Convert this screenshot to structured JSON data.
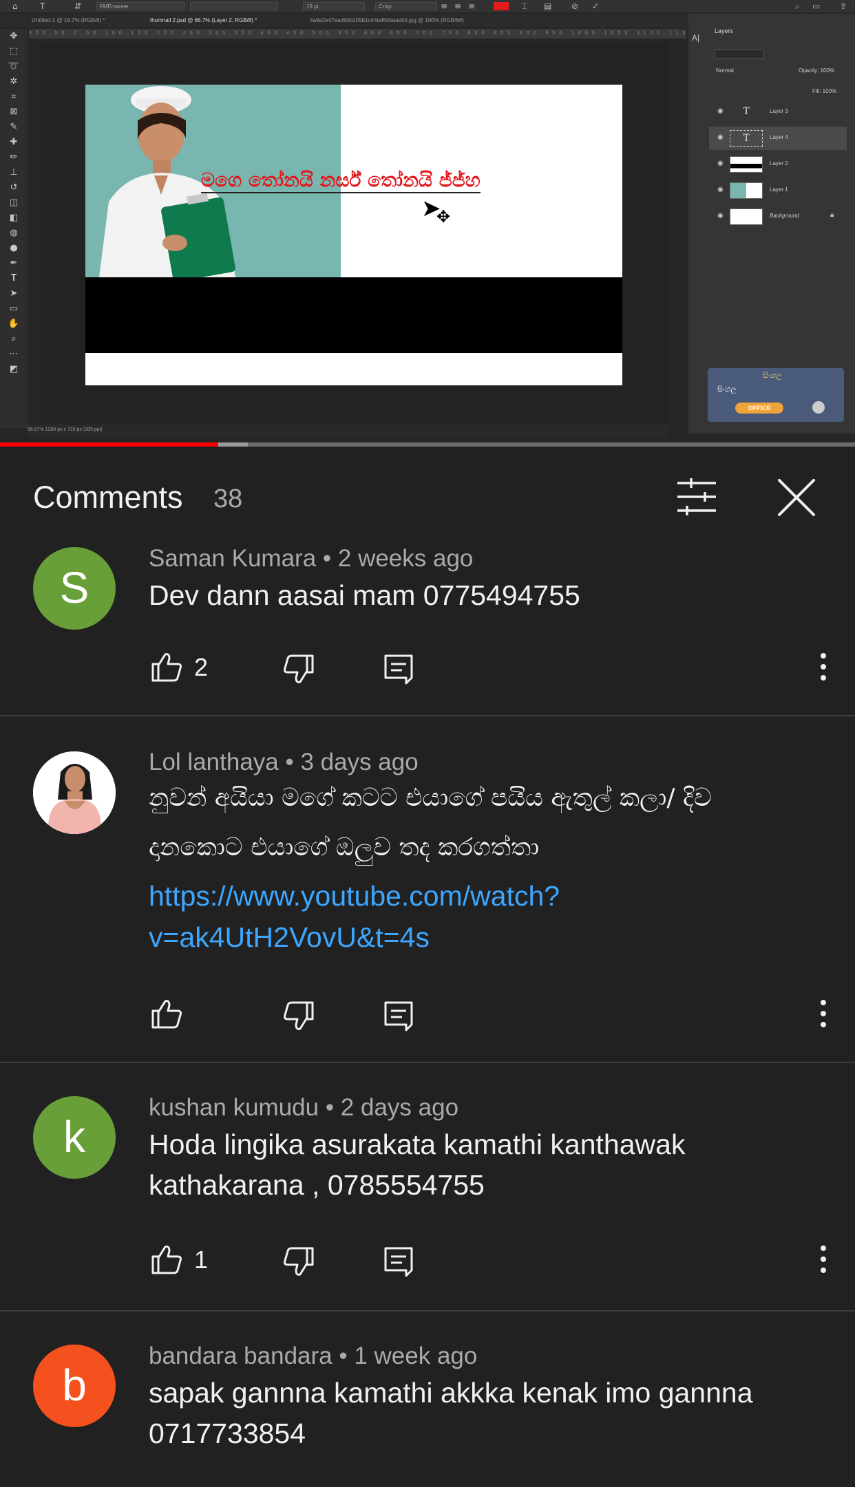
{
  "video": {
    "photoshop": {
      "tabs": [
        "Untitled-1 @ 16.7% (RGB/8) *",
        "thumnail 2.psd @ 66.7% (Layer 2, RGB/8) *",
        "4a9a2e47ead90b205b1c44ed64baae55.jpg @ 100% (RGB/8#)"
      ],
      "font_field": "FMEmanee",
      "size_field": "15 pt",
      "aa_field": "Crisp",
      "ruler_text": "300 50 0 50 100 150 200 250 300 350 400 450 500 550 600 650 700 750 800 850 900 950 1000 1050 1100 1150 1200 1250 1300 1350",
      "canvas_title_text": "මගෙ තෝනයි නර්ස් තෝනයි ජ්ජ්හ",
      "status_text": "66.67%     1280 px x 720 px (305 ppi)",
      "layers_tab": "Layers",
      "blend_mode": "Normal",
      "opacity": "Opacity: 100%",
      "fill": "Fill: 100%",
      "layers": [
        {
          "name": "Layer 3",
          "thumb": "T"
        },
        {
          "name": "Layer 4",
          "thumb": "T"
        },
        {
          "name": "Layer 2",
          "thumb": ""
        },
        {
          "name": "Layer 1",
          "thumb": ""
        },
        {
          "name": "Background",
          "thumb": ""
        }
      ],
      "ime_label": "සිංහල",
      "ime_office": "OFFICE"
    },
    "progress": {
      "played_fraction": 0.255,
      "buffered_fraction": 0.29
    }
  },
  "comments_header": {
    "title": "Comments",
    "count": "38",
    "filter_icon": "filter-sliders-icon",
    "close_icon": "close-icon"
  },
  "comments": [
    {
      "author": "Saman Kumara",
      "time": "2 weeks ago",
      "meta": "Saman Kumara • 2 weeks ago",
      "avatar_letter": "S",
      "avatar_color": "#689f38",
      "text": "Dev dann aasai mam 0775494755",
      "likes": "2"
    },
    {
      "author": "Lol lanthaya",
      "time": "3 days ago",
      "meta": "Lol lanthaya • 3 days ago",
      "avatar_letter": "",
      "avatar_color": "#ffffff",
      "text_line1": "නුවන් අයියා මගේ කටට එයාගේ පයිය ඇතුල් කලා/ දිව",
      "text_line2": "දානකොට එයාගේ ඔලුව තද කරගත්තා",
      "link_line1": "https://www.youtube.com/watch?",
      "link_line2": "v=ak4UtH2VovU&t=4s",
      "likes": ""
    },
    {
      "author": "kushan kumudu",
      "time": "2 days ago",
      "meta": "kushan kumudu • 2 days ago",
      "avatar_letter": "k",
      "avatar_color": "#689f38",
      "text_line1": "Hoda lingika asurakata kamathi kanthawak",
      "text_line2": "kathakarana , 0785554755",
      "likes": "1"
    },
    {
      "author": "bandara bandara",
      "time": "1 week ago",
      "meta": "bandara bandara • 1 week ago",
      "avatar_letter": "b",
      "avatar_color": "#f4511e",
      "text_line1": "sapak gannna kamathi akkka kenak imo gannna",
      "text_line2": "0717733854"
    }
  ],
  "colors": {
    "background": "#212121",
    "text_primary": "#f1f1f1",
    "text_secondary": "#aaaaaa",
    "link": "#3ea6ff",
    "progress_played": "#ff0000"
  }
}
